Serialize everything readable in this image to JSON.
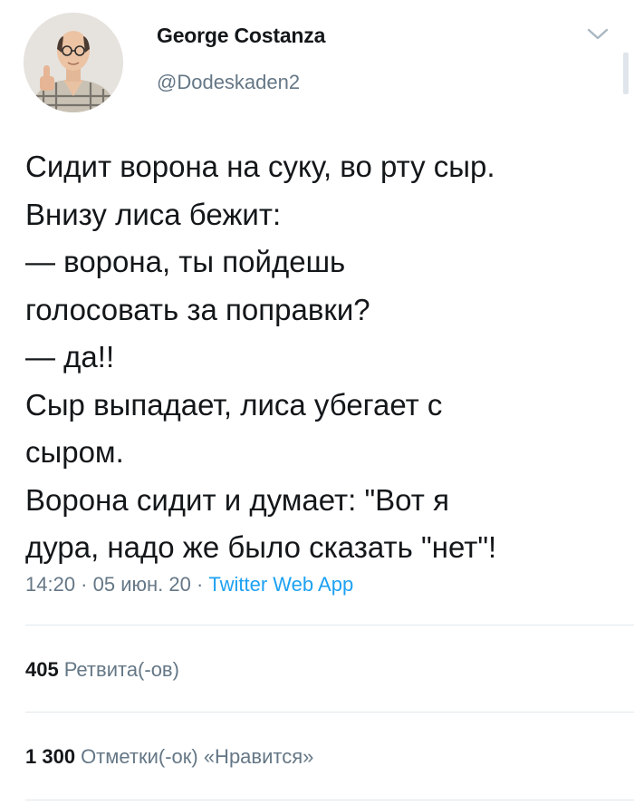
{
  "tweet": {
    "author": {
      "display_name": "George Costanza",
      "username": "@Dodeskaden2"
    },
    "text_lines": [
      "Сидит ворона на суку, во рту сыр.",
      "Внизу лиса бежит:",
      "— ворона, ты пойдешь",
      "голосовать за поправки?",
      "— да!!",
      "Сыр выпадает, лиса убегает с",
      "сыром.",
      "Ворона сидит и думает: \"Вот я",
      "дура, надо же было сказать \"нет\"!"
    ],
    "meta": {
      "time": "14:20",
      "separator1": " · ",
      "date": "05 июн. 20",
      "separator2": " · ",
      "source": "Twitter Web App"
    },
    "stats": {
      "retweets_count": "405",
      "retweets_label": "Ретвита(-ов)",
      "likes_count": "1 300",
      "likes_label": "Отметки(-ок) «Нравится»"
    }
  },
  "icons": {
    "menu": "chevron-down-icon",
    "avatar": "avatar"
  },
  "colors": {
    "text": "#14171a",
    "secondary": "#657786",
    "link": "#1da1f2",
    "divider": "#e1e8ed"
  }
}
